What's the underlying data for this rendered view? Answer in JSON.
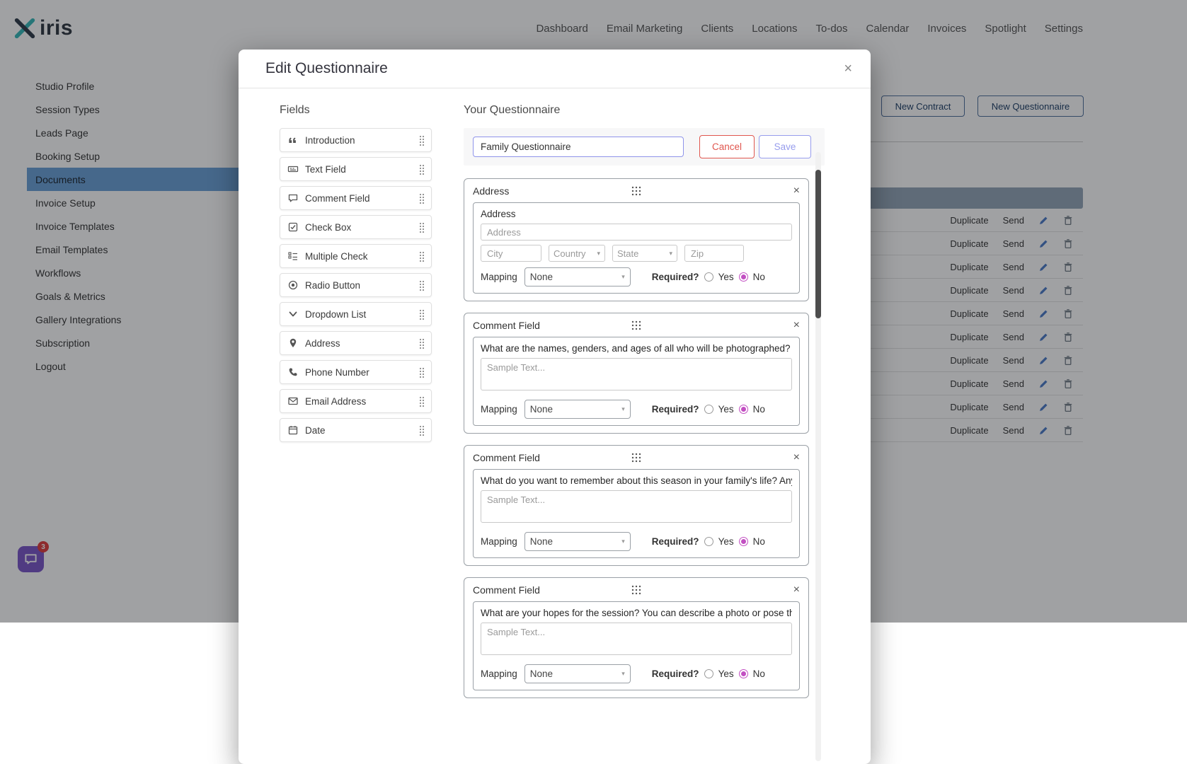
{
  "chrome": {
    "logo_text": "iris",
    "nav_items": [
      "Dashboard",
      "Email Marketing",
      "Clients",
      "Locations",
      "To-dos",
      "Calendar",
      "Invoices",
      "Spotlight",
      "Settings"
    ]
  },
  "sidebar": {
    "items": [
      "Studio Profile",
      "Session Types",
      "Leads Page",
      "Booking Setup",
      "Documents",
      "Invoice Setup",
      "Invoice Templates",
      "Email Templates",
      "Workflows",
      "Goals & Metrics",
      "Gallery Integrations",
      "Subscription",
      "Logout"
    ],
    "active_item": "Documents"
  },
  "content": {
    "new_contract_label": "New Contract",
    "new_questionnaire_label": "New Questionnaire",
    "row_actions": {
      "duplicate": "Duplicate",
      "send": "Send"
    }
  },
  "chat": {
    "badge_count": "3"
  },
  "modal": {
    "title": "Edit Questionnaire",
    "close_label": "×",
    "fields_panel": {
      "heading": "Fields",
      "items": [
        {
          "label": "Introduction",
          "icon": "quote-icon"
        },
        {
          "label": "Text Field",
          "icon": "text-field-icon"
        },
        {
          "label": "Comment Field",
          "icon": "comment-icon"
        },
        {
          "label": "Check Box",
          "icon": "checkbox-icon"
        },
        {
          "label": "Multiple Check",
          "icon": "multiple-check-icon"
        },
        {
          "label": "Radio Button",
          "icon": "radio-icon"
        },
        {
          "label": "Dropdown List",
          "icon": "chevron-down-icon"
        },
        {
          "label": "Address",
          "icon": "map-pin-icon"
        },
        {
          "label": "Phone Number",
          "icon": "phone-icon"
        },
        {
          "label": "Email Address",
          "icon": "envelope-icon"
        },
        {
          "label": "Date",
          "icon": "calendar-icon"
        }
      ]
    },
    "editor": {
      "heading": "Your Questionnaire",
      "name_value": "Family Questionnaire",
      "cancel_label": "Cancel",
      "save_label": "Save"
    },
    "common": {
      "mapping_label": "Mapping",
      "mapping_value": "None",
      "required_label": "Required?",
      "yes_label": "Yes",
      "no_label": "No",
      "sample_placeholder": "Sample Text..."
    },
    "cards": [
      {
        "type": "Address",
        "label": "Address",
        "address_placeholder": "Address",
        "city_placeholder": "City",
        "country_value": "Country",
        "state_value": "State",
        "zip_placeholder": "Zip",
        "required": "No"
      },
      {
        "type": "Comment Field",
        "question": "What are the names, genders, and ages of all who will be photographed?",
        "required": "No"
      },
      {
        "type": "Comment Field",
        "question": "What do you want to remember about this season in your family's life? Any details I s",
        "required": "No"
      },
      {
        "type": "Comment Field",
        "question": "What are your hopes for the session? You can describe a photo or pose that you love,",
        "required": "No"
      }
    ]
  }
}
